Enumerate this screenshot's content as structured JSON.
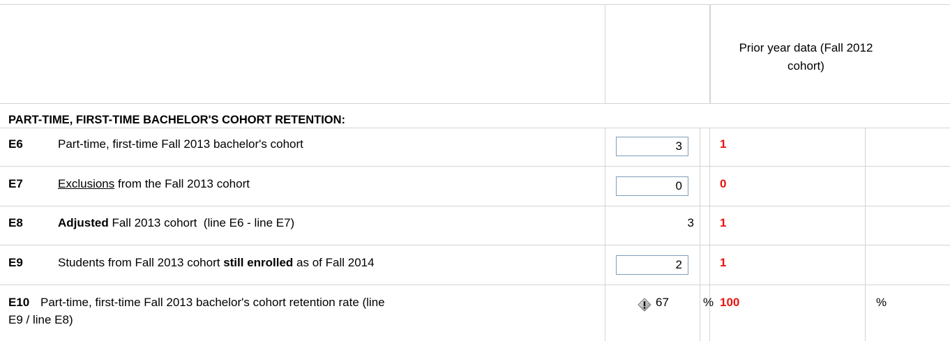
{
  "header": {
    "prior_year_title": "Prior year data (Fall 2012 cohort)"
  },
  "section": {
    "title": "PART-TIME, FIRST-TIME BACHELOR'S COHORT RETENTION:"
  },
  "rows": [
    {
      "code": "E6",
      "label": "Part-time, first-time Fall 2013 bachelor's cohort",
      "value": "3",
      "prior": "1"
    },
    {
      "code": "E7",
      "label_link": "Exclusions",
      "label_rest": " from the Fall 2013 cohort",
      "value": "0",
      "prior": "0"
    },
    {
      "code": "E8",
      "label_bold": "Adjusted",
      "label_rest": " Fall 2013 cohort  (line E6 - line E7)",
      "value": "3",
      "prior": "1"
    },
    {
      "code": "E9",
      "label_pre": "Students from Fall 2013 cohort ",
      "label_bold": "still enrolled",
      "label_post": " as of Fall 2014",
      "value": "2",
      "prior": "1"
    },
    {
      "code": "E10",
      "label_line1": "Part-time, first-time Fall 2013 bachelor's cohort retention rate (line",
      "label_line2": "E9 / line E8)",
      "value": "67",
      "unit": "%",
      "prior": "100",
      "prior_unit": "%"
    }
  ],
  "colors": {
    "prior_value": "#e8140f",
    "grid": "#d4d4d4",
    "input_border": "#7f9db9"
  }
}
